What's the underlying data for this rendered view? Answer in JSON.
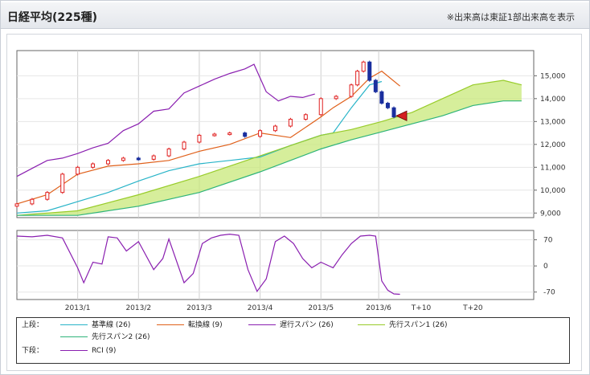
{
  "header": {
    "title": "日経平均(225種)",
    "note": "※出来高は東証1部出来高を表示"
  },
  "colors": {
    "kijun": "#28b4c8",
    "tenkan": "#e0601a",
    "chikou": "#8a1fb0",
    "span1": "#98cc2a",
    "span2": "#2fb47a",
    "rci": "#8a1fb0",
    "candle_up": "#e02020",
    "candle_down": "#1a2f9e"
  },
  "chart_data": [
    {
      "type": "line",
      "title": "日経平均(225種)",
      "y_ticks": [
        "15,000",
        "14,000",
        "13,000",
        "12,000",
        "11,000",
        "10,000",
        "9,000"
      ],
      "ylim": [
        8800,
        16100
      ],
      "x_ticks": [
        "2013/1",
        "2013/2",
        "2013/3",
        "2013/4",
        "2013/5",
        "2013/6",
        "T+10",
        "T+20"
      ],
      "grid": true,
      "series": [
        {
          "name": "基準線 (26)",
          "x": [
            0,
            10,
            20,
            30,
            40,
            50,
            60,
            70,
            80,
            90,
            100,
            104,
            110,
            116,
            120
          ],
          "values": [
            9000,
            9100,
            9500,
            9900,
            10400,
            10850,
            11150,
            11300,
            11450,
            11950,
            12400,
            12500,
            13600,
            14600,
            14750
          ]
        },
        {
          "name": "転換線 (9)",
          "x": [
            0,
            10,
            20,
            30,
            40,
            50,
            60,
            70,
            80,
            90,
            100,
            104,
            110,
            116,
            120,
            126
          ],
          "values": [
            9400,
            9800,
            10700,
            11050,
            11150,
            11300,
            11700,
            12000,
            12500,
            12300,
            13200,
            13600,
            14100,
            14900,
            15200,
            14550
          ]
        },
        {
          "name": "遅行スパン (26)",
          "x": [
            0,
            5,
            10,
            15,
            20,
            25,
            30,
            35,
            40,
            45,
            50,
            55,
            60,
            65,
            70,
            75,
            78,
            82,
            86,
            90,
            94,
            98
          ],
          "values": [
            10600,
            10950,
            11300,
            11400,
            11600,
            11850,
            12050,
            12600,
            12900,
            13450,
            13550,
            14250,
            14550,
            14850,
            15100,
            15300,
            15500,
            14300,
            13900,
            14100,
            14050,
            14200
          ]
        },
        {
          "name": "先行スパン1 (26)",
          "x": [
            0,
            20,
            40,
            60,
            80,
            100,
            110,
            120,
            130,
            140,
            150,
            160,
            166
          ],
          "values": [
            8900,
            9100,
            9800,
            10600,
            11500,
            12400,
            12650,
            13000,
            13400,
            14000,
            14600,
            14800,
            14600
          ]
        },
        {
          "name": "先行スパン2 (26)",
          "x": [
            0,
            20,
            40,
            60,
            80,
            100,
            110,
            120,
            130,
            140,
            150,
            160,
            166
          ],
          "values": [
            8900,
            8900,
            9300,
            9900,
            10800,
            11800,
            12200,
            12550,
            12900,
            13250,
            13700,
            13900,
            13900
          ]
        }
      ],
      "candles_close_approx": {
        "x": [
          0,
          5,
          10,
          15,
          20,
          25,
          30,
          35,
          40,
          45,
          50,
          55,
          60,
          65,
          70,
          75,
          80,
          85,
          90,
          95,
          100,
          105,
          110,
          112,
          114,
          116,
          118,
          120,
          122,
          124
        ],
        "values": [
          9400,
          9600,
          9900,
          10700,
          11000,
          11150,
          11300,
          11400,
          11350,
          11500,
          11800,
          12100,
          12400,
          12450,
          12500,
          12350,
          12600,
          12800,
          13100,
          13300,
          14000,
          14100,
          14600,
          15200,
          15600,
          14800,
          14300,
          13800,
          13600,
          13200
        ]
      },
      "last_marker_value": 13250
    },
    {
      "type": "line",
      "title": "",
      "y_ticks": [
        "70",
        "0",
        "-70"
      ],
      "ylim": [
        -90,
        95
      ],
      "series": [
        {
          "name": "RCI (9)",
          "x": [
            0,
            5,
            10,
            15,
            20,
            22,
            25,
            28,
            30,
            33,
            36,
            40,
            45,
            48,
            50,
            55,
            58,
            61,
            64,
            67,
            70,
            73,
            76,
            79,
            82,
            85,
            88,
            91,
            94,
            97,
            100,
            104,
            107,
            110,
            113,
            116,
            118,
            120,
            122,
            124,
            126
          ],
          "values": [
            80,
            78,
            82,
            75,
            -5,
            -45,
            10,
            5,
            78,
            75,
            40,
            65,
            -10,
            20,
            72,
            -45,
            -20,
            60,
            75,
            82,
            85,
            82,
            -10,
            -68,
            -35,
            65,
            80,
            60,
            20,
            -5,
            10,
            -5,
            30,
            60,
            80,
            82,
            80,
            -40,
            -65,
            -75,
            -76
          ]
        }
      ]
    }
  ],
  "legend": {
    "upper_label": "上段：",
    "lower_label": "下段：",
    "items_row1": [
      {
        "label": "基準線 (26)",
        "color": "#28b4c8"
      },
      {
        "label": "転換線 (9)",
        "color": "#e0601a"
      },
      {
        "label": "遅行スパン (26)",
        "color": "#8a1fb0"
      },
      {
        "label": "先行スパン1 (26)",
        "color": "#98cc2a"
      }
    ],
    "items_row2": [
      {
        "label": "先行スパン2 (26)",
        "color": "#2fb47a"
      }
    ],
    "items_row3": [
      {
        "label": "RCI (9)",
        "color": "#8a1fb0"
      }
    ]
  }
}
